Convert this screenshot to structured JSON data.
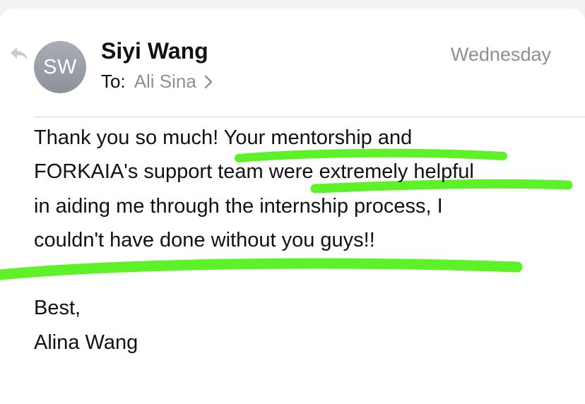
{
  "sender": {
    "initials": "SW",
    "name": "Siyi Wang"
  },
  "recipient": {
    "label": "To:",
    "name": "Ali Sina"
  },
  "date": "Wednesday",
  "body": {
    "lines": [
      "Thank you so much! Your mentorship and",
      "FORKAIA's support team were extremely helpful",
      "in aiding me through the internship process, I",
      "couldn't have done without you guys!!"
    ],
    "closing": "Best,",
    "signature": "Alina Wang"
  },
  "icons": {
    "reply": "reply-arrow-icon",
    "chevron": "chevron-right-icon"
  },
  "colors": {
    "highlight": "#5cf227",
    "secondary_text": "#8e8e93",
    "avatar": "#9ea2aa"
  }
}
